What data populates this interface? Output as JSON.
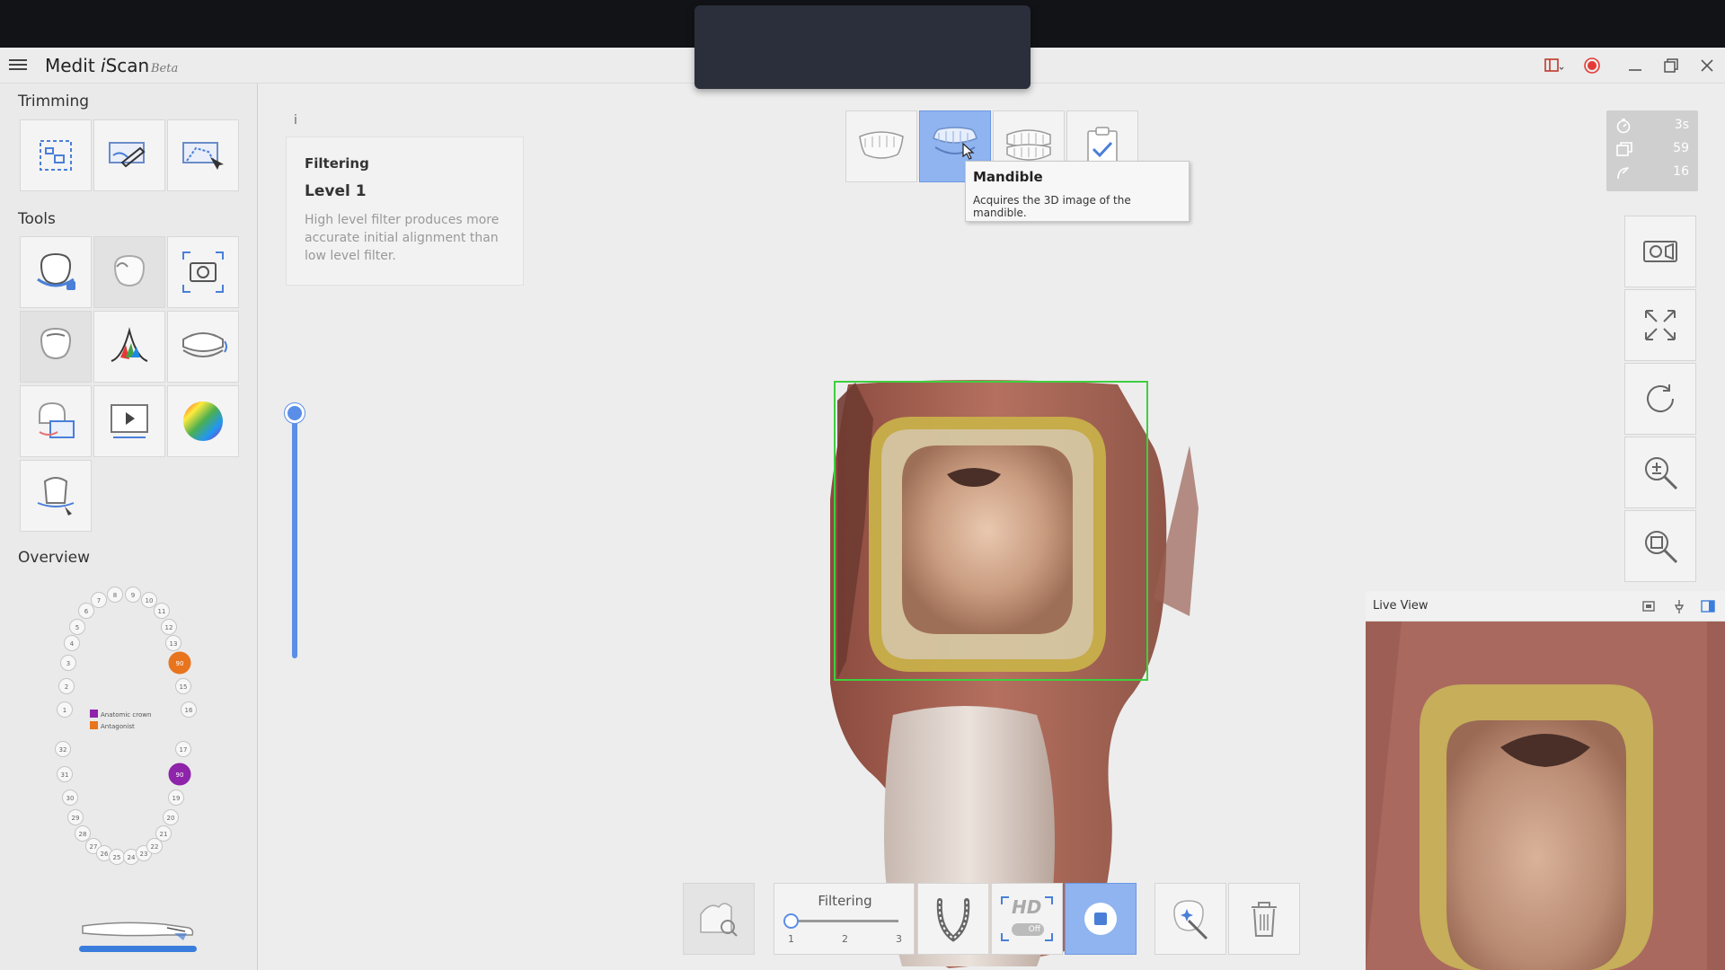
{
  "app": {
    "name_prefix": "Medit ",
    "name_italic": "i",
    "name_suffix": "Scan",
    "beta": "Beta"
  },
  "sidebar": {
    "trimming_title": "Trimming",
    "tools_title": "Tools",
    "overview_title": "Overview",
    "legend": [
      {
        "label": "Anatomic crown",
        "color": "#8e24aa"
      },
      {
        "label": "Antagonist",
        "color": "#e8741e"
      }
    ],
    "teeth_upper_left": [
      "8",
      "7",
      "6",
      "5",
      "4",
      "3",
      "2",
      "1"
    ],
    "teeth_upper_right": [
      "9",
      "10",
      "11",
      "12",
      "13",
      "90",
      "15",
      "16"
    ],
    "teeth_lower_left": [
      "32",
      "31",
      "30",
      "29",
      "28",
      "27",
      "26",
      "25"
    ],
    "teeth_lower_right": [
      "24",
      "23",
      "22",
      "21",
      "20",
      "19",
      "90",
      "17"
    ],
    "highlight_upper": "90",
    "highlight_lower": "90"
  },
  "filter_card": {
    "heading": "Filtering",
    "level": "Level 1",
    "description": "High level filter produces more accurate initial alignment than low level filter."
  },
  "info_icon": "i",
  "stages": [
    {
      "name": "maxilla"
    },
    {
      "name": "mandible",
      "active": true
    },
    {
      "name": "occlusion"
    },
    {
      "name": "complete"
    }
  ],
  "tooltip": {
    "title": "Mandible",
    "description": "Acquires the 3D image of the mandible."
  },
  "stats": {
    "time": "3s",
    "frames": "59",
    "speed": "16"
  },
  "live_view": {
    "title": "Live View"
  },
  "bottom_toolbar": {
    "filter_label": "Filtering",
    "filter_levels": [
      "1",
      "2",
      "3"
    ],
    "filter_value": 1,
    "hd_label": "HD",
    "hd_state": "Off"
  },
  "colors": {
    "accent": "#5b8ee6",
    "active_stage": "#8fb4f0",
    "roi": "#3ecf3e",
    "record": "#e53935"
  }
}
